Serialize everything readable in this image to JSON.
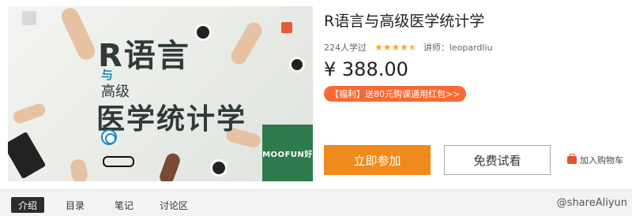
{
  "course": {
    "cover": {
      "line1": "R语言",
      "line2": "与",
      "line3": "高级",
      "line4": "医学统计学",
      "logo_text": "MOOFUN好"
    },
    "title": "R语言与高级医学统计学",
    "learners": "224人学过",
    "rating_stars": 4.5,
    "teacher_label": "讲师：",
    "teacher_name": "leopardliu",
    "price": "¥ 388.00",
    "promo": "【福利】送80元购课通用红包>>"
  },
  "actions": {
    "join_label": "立即参加",
    "trial_label": "免费试看",
    "cart_label": "加入购物车"
  },
  "tabs": [
    {
      "label": "介绍",
      "active": true
    },
    {
      "label": "目录",
      "active": false
    },
    {
      "label": "笔记",
      "active": false
    },
    {
      "label": "讨论区",
      "active": false
    }
  ],
  "watermark": "@shareAliyun",
  "colors": {
    "accent_orange": "#f08a1c",
    "promo_red": "#f86a35",
    "star": "#f5a623"
  }
}
